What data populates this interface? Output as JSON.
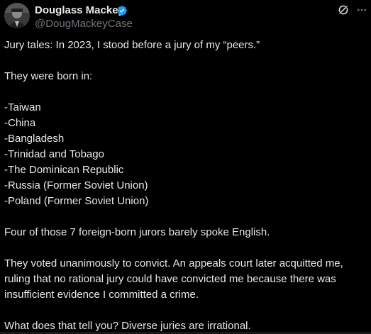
{
  "author": {
    "display_name": "Douglass Mackey",
    "handle": "@DougMackeyCase",
    "verified": true,
    "verified_color": "#1d9bf0"
  },
  "icons": {
    "avatar": "avatar",
    "verified": "verified-badge-icon",
    "grok": "grok-icon",
    "more": "more-options-icon"
  },
  "post": {
    "intro": "Jury tales: In 2023, I stood before a jury of my “peers.”",
    "born_heading": "They were born in:",
    "countries": [
      "-Taiwan",
      "-China",
      "-Bangladesh",
      "-Trinidad and Tobago",
      "-The Dominican Republic",
      "-Russia (Former Soviet Union)",
      "-Poland (Former Soviet Union)"
    ],
    "english_line": "Four of those 7 foreign-born jurors barely spoke English.",
    "verdict_paragraph": "They voted unanimously to convict. An appeals court later acquitted me, ruling that no rational jury could have convicted me because there was insufficient evidence I committed a crime.",
    "closing": "What does that tell you? Diverse juries are irrational."
  },
  "colors": {
    "background": "#000000",
    "primary_text": "#e7e9ea",
    "secondary_text": "#71767b"
  }
}
